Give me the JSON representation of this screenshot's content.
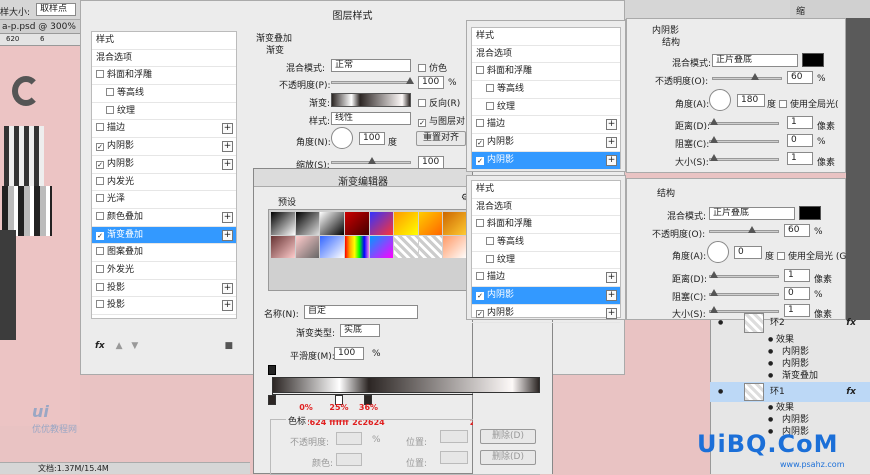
{
  "ps": {
    "size_label": "样大小:",
    "size_value": "取样点",
    "doc_tab": "a-p.psd @ 300% (",
    "ruler": [
      "620",
      "6",
      "",
      "680",
      "700"
    ],
    "doc_info": "文档:1.37M/15.4M",
    "logo_text": "优优教程网"
  },
  "layer_style": {
    "title": "图层样式",
    "styles_head": "样式",
    "items": [
      {
        "label": "混合选项",
        "cb": "none",
        "plus": false,
        "ind": false
      },
      {
        "label": "斜面和浮雕",
        "cb": "off",
        "plus": false,
        "ind": false
      },
      {
        "label": "等高线",
        "cb": "off",
        "plus": false,
        "ind": true
      },
      {
        "label": "纹理",
        "cb": "off",
        "plus": false,
        "ind": true
      },
      {
        "label": "描边",
        "cb": "off",
        "plus": true,
        "ind": false
      },
      {
        "label": "内阴影",
        "cb": "on",
        "plus": true,
        "ind": false
      },
      {
        "label": "内阴影",
        "cb": "on",
        "plus": true,
        "ind": false
      },
      {
        "label": "内发光",
        "cb": "off",
        "plus": false,
        "ind": false
      },
      {
        "label": "光泽",
        "cb": "off",
        "plus": false,
        "ind": false
      },
      {
        "label": "颜色叠加",
        "cb": "off",
        "plus": true,
        "ind": false
      },
      {
        "label": "渐变叠加",
        "cb": "on",
        "plus": true,
        "ind": false,
        "sel": true
      },
      {
        "label": "图案叠加",
        "cb": "off",
        "plus": false,
        "ind": false
      },
      {
        "label": "外发光",
        "cb": "off",
        "plus": false,
        "ind": false
      },
      {
        "label": "投影",
        "cb": "off",
        "plus": true,
        "ind": false
      },
      {
        "label": "投影",
        "cb": "off",
        "plus": true,
        "ind": false
      }
    ],
    "fx": "fx",
    "gradient_overlay": {
      "group": "渐变叠加",
      "sub": "渐变",
      "blend_label": "混合模式:",
      "blend_value": "正常",
      "dither_label": "仿色",
      "opacity_label": "不透明度(P):",
      "opacity_value": "100",
      "pct": "%",
      "gradient_label": "渐变:",
      "reverse_label": "反向(R)",
      "style_label": "样式:",
      "style_value": "线性",
      "align_label": "与图层对",
      "angle_label": "角度(N):",
      "angle_value": "100",
      "degree": "度",
      "reset_btn": "重置对齐",
      "scale_label": "缩放(S):",
      "scale_value": "100"
    }
  },
  "gradient_editor": {
    "title": "渐变编辑器",
    "presets_label": "预设",
    "name_label": "名称(N):",
    "name_value": "自定",
    "type_label": "渐变类型:",
    "type_value": "实底",
    "smooth_label": "平滑度(M):",
    "smooth_value": "100",
    "pct": "%",
    "stops": [
      {
        "pos": "0%",
        "color": "2c2624",
        "at": 0
      },
      {
        "pos": "25%",
        "color": "ffffff",
        "at": 25
      },
      {
        "pos": "36%",
        "color": "2c2624",
        "at": 36
      },
      {
        "pos": "90%",
        "color": "fdf9f8",
        "at": 90
      },
      {
        "pos": "100%",
        "color": "2c2624",
        "at": 100
      }
    ],
    "stops_group": "色标",
    "opacity_label": "不透明度:",
    "location_label": "位置:",
    "delete_btn": "删除(D)",
    "color_label": "颜色:"
  },
  "styles_panel_1": {
    "head": "样式",
    "items": [
      {
        "label": "混合选项",
        "cb": "none",
        "plus": false,
        "ind": false
      },
      {
        "label": "斜面和浮雕",
        "cb": "off",
        "plus": false,
        "ind": false
      },
      {
        "label": "等高线",
        "cb": "off",
        "plus": false,
        "ind": true
      },
      {
        "label": "纹理",
        "cb": "off",
        "plus": false,
        "ind": true
      },
      {
        "label": "描边",
        "cb": "off",
        "plus": true,
        "ind": false
      },
      {
        "label": "内阴影",
        "cb": "on",
        "plus": true,
        "ind": false
      },
      {
        "label": "内阴影",
        "cb": "on",
        "plus": true,
        "ind": false,
        "sel": true
      }
    ]
  },
  "styles_panel_2": {
    "head": "样式",
    "items": [
      {
        "label": "混合选项",
        "cb": "none",
        "plus": false,
        "ind": false
      },
      {
        "label": "斜面和浮雕",
        "cb": "off",
        "plus": false,
        "ind": false
      },
      {
        "label": "等高线",
        "cb": "off",
        "plus": false,
        "ind": true
      },
      {
        "label": "纹理",
        "cb": "off",
        "plus": false,
        "ind": true
      },
      {
        "label": "描边",
        "cb": "off",
        "plus": true,
        "ind": false
      },
      {
        "label": "内阴影",
        "cb": "on",
        "plus": true,
        "ind": false,
        "sel": true
      },
      {
        "label": "内阴影",
        "cb": "on",
        "plus": true,
        "ind": false
      }
    ]
  },
  "inner_shadow_1": {
    "group": "内阴影",
    "sub": "结构",
    "blend_label": "混合模式:",
    "blend_value": "正片叠底",
    "opacity_label": "不透明度(O):",
    "opacity_value": "60",
    "pct": "%",
    "angle_label": "角度(A):",
    "angle_value": "180",
    "degree": "度",
    "global_label": "使用全局光(",
    "distance_label": "距离(D):",
    "distance_value": "1",
    "px": "像素",
    "choke_label": "阻塞(C):",
    "choke_value": "0",
    "size_label": "大小(S):",
    "size_value": "1"
  },
  "inner_shadow_2": {
    "sub": "结构",
    "blend_label": "混合模式:",
    "blend_value": "正片叠底",
    "opacity_label": "不透明度(O):",
    "opacity_value": "60",
    "pct": "%",
    "angle_label": "角度(A):",
    "angle_value": "0",
    "degree": "度",
    "global_label": "使用全局光 (G",
    "distance_label": "距离(D):",
    "distance_value": "1",
    "px": "像素",
    "choke_label": "阻塞(C):",
    "choke_value": "0",
    "size_label": "大小(S):",
    "size_value": "1"
  },
  "layers": {
    "top_tab": "缩",
    "rows": [
      {
        "name": "环2",
        "fx": "fx",
        "type": "layer"
      },
      {
        "name": "效果",
        "type": "effects"
      },
      {
        "name": "内阴影",
        "type": "effect"
      },
      {
        "name": "内阴影",
        "type": "effect"
      },
      {
        "name": "渐变叠加",
        "type": "effect"
      },
      {
        "name": "环1",
        "fx": "fx",
        "type": "layer",
        "sel": true
      },
      {
        "name": "效果",
        "type": "effects"
      },
      {
        "name": "内阴影",
        "type": "effect"
      },
      {
        "name": "内阴影",
        "type": "effect"
      }
    ]
  },
  "watermark": {
    "main": "UiBQ.CoM",
    "sub": "www.psahz.com"
  },
  "colors": {
    "selection": "#3399ff",
    "stop_label": "#e02020"
  }
}
